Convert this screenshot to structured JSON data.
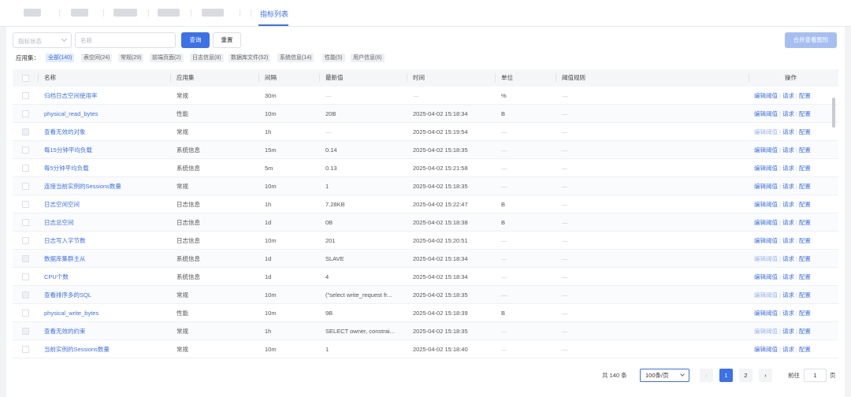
{
  "tabs": {
    "active_label": "指标列表"
  },
  "filters": {
    "status_placeholder": "指标状态",
    "name_placeholder": "名称",
    "query_label": "查询",
    "reset_label": "重置",
    "merge_label": "合并查看图形"
  },
  "appset": {
    "label": "应用集：",
    "chips": [
      "全部(140)",
      "表空间(24)",
      "常规(29)",
      "前端页面(2)",
      "日志信息(8)",
      "数据库文件(52)",
      "系统信息(14)",
      "性能(5)",
      "用户信息(6)"
    ]
  },
  "table": {
    "headers": [
      "名称",
      "应用集",
      "间隔",
      "最新值",
      "时间",
      "单位",
      "阈值规则",
      "操作"
    ],
    "rows": [
      {
        "name": "归档日志空间使用率",
        "appset": "常规",
        "interval": "30m",
        "value": "—",
        "time": "—",
        "unit": "%",
        "rule": "—",
        "cb_disabled": false,
        "ops_disabled": false
      },
      {
        "name": "physical_read_bytes",
        "appset": "性能",
        "interval": "10m",
        "value": "20B",
        "time": "2025-04-02 15:18:34",
        "unit": "B",
        "rule": "—",
        "cb_disabled": false,
        "ops_disabled": false
      },
      {
        "name": "查看无效的对象",
        "appset": "常规",
        "interval": "1h",
        "value": "—",
        "time": "2025-04-02 15:19:54",
        "unit": "—",
        "rule": "—",
        "cb_disabled": true,
        "ops_disabled": true
      },
      {
        "name": "每15分钟平均负载",
        "appset": "系统信息",
        "interval": "15m",
        "value": "0.14",
        "time": "2025-04-02 15:18:35",
        "unit": "—",
        "rule": "—",
        "cb_disabled": false,
        "ops_disabled": false
      },
      {
        "name": "每5分钟平均负载",
        "appset": "系统信息",
        "interval": "5m",
        "value": "0.13",
        "time": "2025-04-02 15:21:58",
        "unit": "—",
        "rule": "—",
        "cb_disabled": false,
        "ops_disabled": false
      },
      {
        "name": "连接当前实例的Sessions数量",
        "appset": "常规",
        "interval": "10m",
        "value": "1",
        "time": "2025-04-02 15:18:35",
        "unit": "—",
        "rule": "—",
        "cb_disabled": false,
        "ops_disabled": false
      },
      {
        "name": "日志空闲空间",
        "appset": "日志信息",
        "interval": "1h",
        "value": "7.28KB",
        "time": "2025-04-02 15:22:47",
        "unit": "B",
        "rule": "—",
        "cb_disabled": false,
        "ops_disabled": false
      },
      {
        "name": "日志总空间",
        "appset": "日志信息",
        "interval": "1d",
        "value": "0B",
        "time": "2025-04-02 15:18:38",
        "unit": "B",
        "rule": "—",
        "cb_disabled": false,
        "ops_disabled": false
      },
      {
        "name": "日志写入字节数",
        "appset": "日志信息",
        "interval": "10m",
        "value": "201",
        "time": "2025-04-02 15:20:51",
        "unit": "—",
        "rule": "—",
        "cb_disabled": false,
        "ops_disabled": false
      },
      {
        "name": "数据库集群主从",
        "appset": "系统信息",
        "interval": "1d",
        "value": "SLAVE",
        "time": "2025-04-02 15:18:34",
        "unit": "—",
        "rule": "—",
        "cb_disabled": true,
        "ops_disabled": true
      },
      {
        "name": "CPU个数",
        "appset": "系统信息",
        "interval": "1d",
        "value": "4",
        "time": "2025-04-02 15:18:34",
        "unit": "—",
        "rule": "—",
        "cb_disabled": false,
        "ops_disabled": false
      },
      {
        "name": "查看排序多的SQL",
        "appset": "常规",
        "interval": "10m",
        "value": "(\"select write_request fr...",
        "time": "2025-04-02 15:18:35",
        "unit": "—",
        "rule": "—",
        "cb_disabled": true,
        "ops_disabled": true
      },
      {
        "name": "physical_write_bytes",
        "appset": "性能",
        "interval": "10m",
        "value": "9B",
        "time": "2025-04-02 15:18:39",
        "unit": "B",
        "rule": "—",
        "cb_disabled": false,
        "ops_disabled": false
      },
      {
        "name": "查看无效的约束",
        "appset": "常规",
        "interval": "1h",
        "value": "SELECT owner, constrai...",
        "time": "2025-04-02 15:18:35",
        "unit": "—",
        "rule": "—",
        "cb_disabled": true,
        "ops_disabled": true
      },
      {
        "name": "当前实例的Sessions数量",
        "appset": "常规",
        "interval": "10m",
        "value": "1",
        "time": "2025-04-02 15:18:40",
        "unit": "—",
        "rule": "—",
        "cb_disabled": false,
        "ops_disabled": false
      }
    ],
    "ops": {
      "edit": "编辑阈值",
      "request": "请求",
      "config": "配置"
    }
  },
  "pagination": {
    "total": "共 140 条",
    "page_size": "100条/页",
    "prev": "‹",
    "next": "›",
    "pages": [
      "1",
      "2"
    ],
    "goto_label": "前往",
    "goto_value": "1",
    "goto_unit": "页"
  },
  "colors": {
    "accent": "#3c71e8",
    "accent_light": "#a6bff2",
    "muted": "#c2c5cb"
  }
}
